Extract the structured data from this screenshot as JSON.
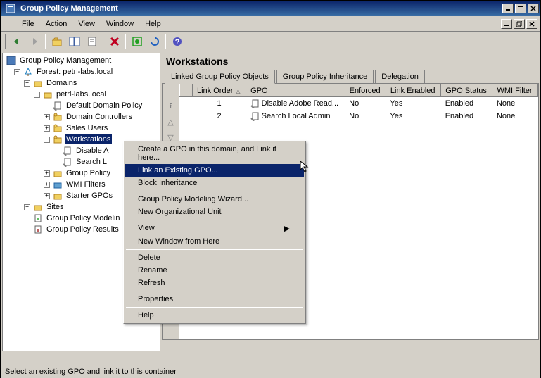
{
  "window": {
    "title": "Group Policy Management"
  },
  "menubar": [
    "File",
    "Action",
    "View",
    "Window",
    "Help"
  ],
  "tree": {
    "root": "Group Policy Management",
    "forest": "Forest: petri-labs.local",
    "domains": "Domains",
    "domain": "petri-labs.local",
    "items": {
      "default_policy": "Default Domain Policy",
      "dc": "Domain Controllers",
      "sales": "Sales Users",
      "workstations": "Workstations",
      "disable": "Disable A",
      "search": "Search L",
      "gpo": "Group Policy",
      "wmi": "WMI Filters",
      "starter": "Starter GPOs"
    },
    "sites": "Sites",
    "modeling": "Group Policy Modelin",
    "results": "Group Policy Results"
  },
  "content": {
    "title": "Workstations",
    "tabs": [
      "Linked Group Policy Objects",
      "Group Policy Inheritance",
      "Delegation"
    ],
    "columns": [
      "Link Order",
      "GPO",
      "Enforced",
      "Link Enabled",
      "GPO Status",
      "WMI Filter"
    ],
    "rows": [
      {
        "order": "1",
        "gpo": "Disable Adobe Read...",
        "enforced": "No",
        "enabled": "Yes",
        "status": "Enabled",
        "wmi": "None"
      },
      {
        "order": "2",
        "gpo": "Search Local Admin",
        "enforced": "No",
        "enabled": "Yes",
        "status": "Enabled",
        "wmi": "None"
      }
    ]
  },
  "context_menu": {
    "create": "Create a GPO in this domain, and Link it here...",
    "link": "Link an Existing GPO...",
    "block": "Block Inheritance",
    "wizard": "Group Policy Modeling Wizard...",
    "newou": "New Organizational Unit",
    "view": "View",
    "newwin": "New Window from Here",
    "delete": "Delete",
    "rename": "Rename",
    "refresh": "Refresh",
    "props": "Properties",
    "help": "Help"
  },
  "status": "Select an existing GPO and link it to this container"
}
